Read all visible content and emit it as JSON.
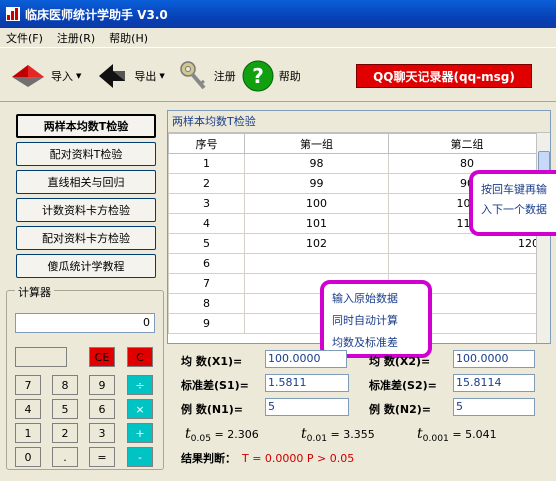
{
  "window": {
    "title": "临床医师统计学助手 V3.0"
  },
  "menu": [
    "文件(F)",
    "注册(R)",
    "帮助(H)"
  ],
  "toolbar": {
    "import": "导入",
    "export": "导出",
    "register": "注册",
    "help": "帮助",
    "qq": "QQ聊天记录器(qq-msg)"
  },
  "left_buttons": [
    "两样本均数T检验",
    "配对资料T检验",
    "直线相关与回归",
    "计数资料卡方检验",
    "配对资料卡方检验",
    "傻瓜统计学教程"
  ],
  "calculator": {
    "label": "计算器",
    "display": "0",
    "ce": "CE",
    "c": "C",
    "keys": [
      "7",
      "8",
      "9",
      "÷",
      "4",
      "5",
      "6",
      "×",
      "1",
      "2",
      "3",
      "+",
      "0",
      ".",
      "=",
      "-"
    ]
  },
  "panel": {
    "title": "两样本均数T检验",
    "columns": [
      "序号",
      "第一组",
      "第二组"
    ],
    "rows": [
      [
        "1",
        "98",
        "80"
      ],
      [
        "2",
        "99",
        "90"
      ],
      [
        "3",
        "100",
        "100"
      ],
      [
        "4",
        "101",
        "110"
      ],
      [
        "5",
        "102",
        "120"
      ],
      [
        "6",
        "",
        ""
      ],
      [
        "7",
        "",
        ""
      ],
      [
        "8",
        "",
        ""
      ],
      [
        "9",
        "",
        ""
      ]
    ]
  },
  "tips": {
    "enter": [
      "按回车键再输",
      "入下一个数据"
    ],
    "input": [
      "输入原始数据",
      "同时自动计算",
      "均数及标准差"
    ]
  },
  "stats": {
    "mean1_label": "均  数(X1)=",
    "mean1": "100.0000",
    "mean2_label": "均  数(X2)=",
    "mean2": "100.0000",
    "sd1_label": "标准差(S1)=",
    "sd1": "1.5811",
    "sd2_label": "标准差(S2)=",
    "sd2": "15.8114",
    "n1_label": "例  数(N1)=",
    "n1": "5",
    "n2_label": "例  数(N2)=",
    "n2": "5",
    "t05": "= 2.306",
    "t01": "= 3.355",
    "t001": "= 5.041",
    "t05_sub": "0.05",
    "t01_sub": "0.01",
    "t001_sub": "0.001",
    "result_label": "结果判断：",
    "result": "T = 0.0000  P > 0.05"
  }
}
